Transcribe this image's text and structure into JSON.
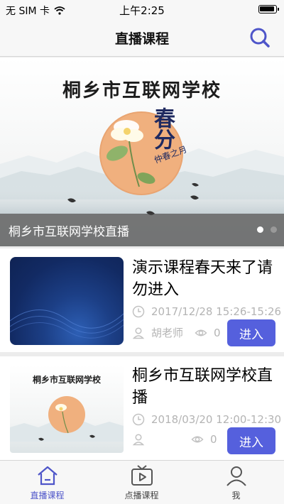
{
  "status_bar": {
    "carrier": "无 SIM 卡",
    "time": "上午2:25"
  },
  "header": {
    "title": "直播课程"
  },
  "banner": {
    "heading": "桐乡市互联网学校",
    "caption": "桐乡市互联网学校直播",
    "seal_text_main": "春分",
    "seal_text_sub": "仲春之月",
    "slide_count": 2,
    "active_slide": 1
  },
  "courses": [
    {
      "title": "演示课程春天来了请勿进入",
      "time": "2017/12/28 15:26-15:26",
      "teacher": "胡老师",
      "views": "0",
      "enter_label": "进入"
    },
    {
      "title": "桐乡市互联网学校直播",
      "time": "2018/03/20 12:00-12:30",
      "teacher": "",
      "views": "0",
      "enter_label": "进入",
      "thumb_heading": "桐乡市互联网学校"
    }
  ],
  "tabs": [
    {
      "label": "直播课程",
      "icon": "home-icon",
      "active": true
    },
    {
      "label": "点播课程",
      "icon": "tv-play-icon",
      "active": false
    },
    {
      "label": "我",
      "icon": "user-icon",
      "active": false
    }
  ],
  "colors": {
    "accent": "#5560dd",
    "tab_active": "#4e55c9",
    "meta_gray": "#b4b4b4"
  }
}
